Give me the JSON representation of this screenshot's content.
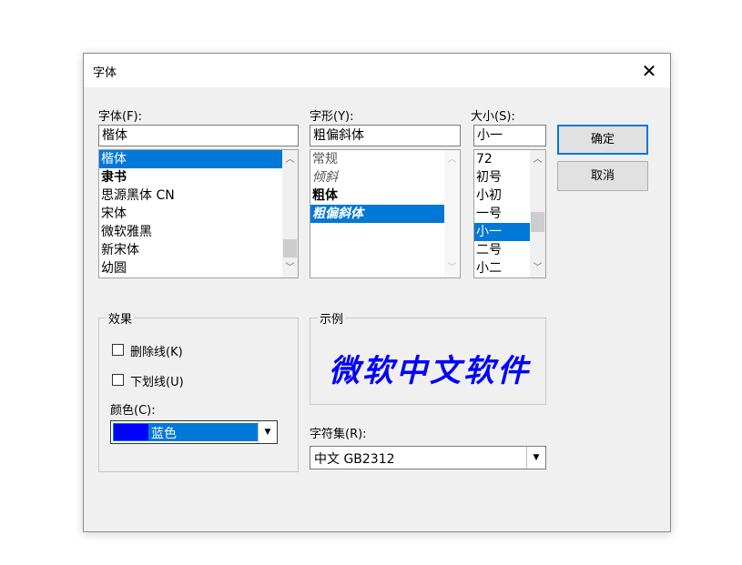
{
  "dialog": {
    "title": "字体"
  },
  "font": {
    "label": "字体(F):",
    "value": "楷体",
    "items": [
      "楷体",
      "隶书",
      "思源黑体 CN",
      "宋体",
      "微软雅黑",
      "新宋体",
      "幼圆"
    ],
    "selected_index": 0
  },
  "style": {
    "label": "字形(Y):",
    "value": "粗偏斜体",
    "items": [
      "常规",
      "倾斜",
      "粗体",
      "粗偏斜体"
    ],
    "selected_index": 3
  },
  "size": {
    "label": "大小(S):",
    "value": "小一",
    "items": [
      "72",
      "初号",
      "小初",
      "一号",
      "小一",
      "二号",
      "小二"
    ],
    "selected_index": 4
  },
  "buttons": {
    "ok": "确定",
    "cancel": "取消"
  },
  "effects": {
    "label": "效果",
    "strikeout": {
      "label": "删除线(K)",
      "checked": false
    },
    "underline": {
      "label": "下划线(U)",
      "checked": false
    },
    "color_label": "颜色(C):",
    "color_value": "蓝色",
    "color_hex": "#0000ff"
  },
  "sample": {
    "label": "示例",
    "text": "微软中文软件"
  },
  "charset": {
    "label": "字符集(R):",
    "value": "中文 GB2312"
  },
  "colors": {
    "accent": "#0078d7",
    "sample": "#0000ff"
  }
}
